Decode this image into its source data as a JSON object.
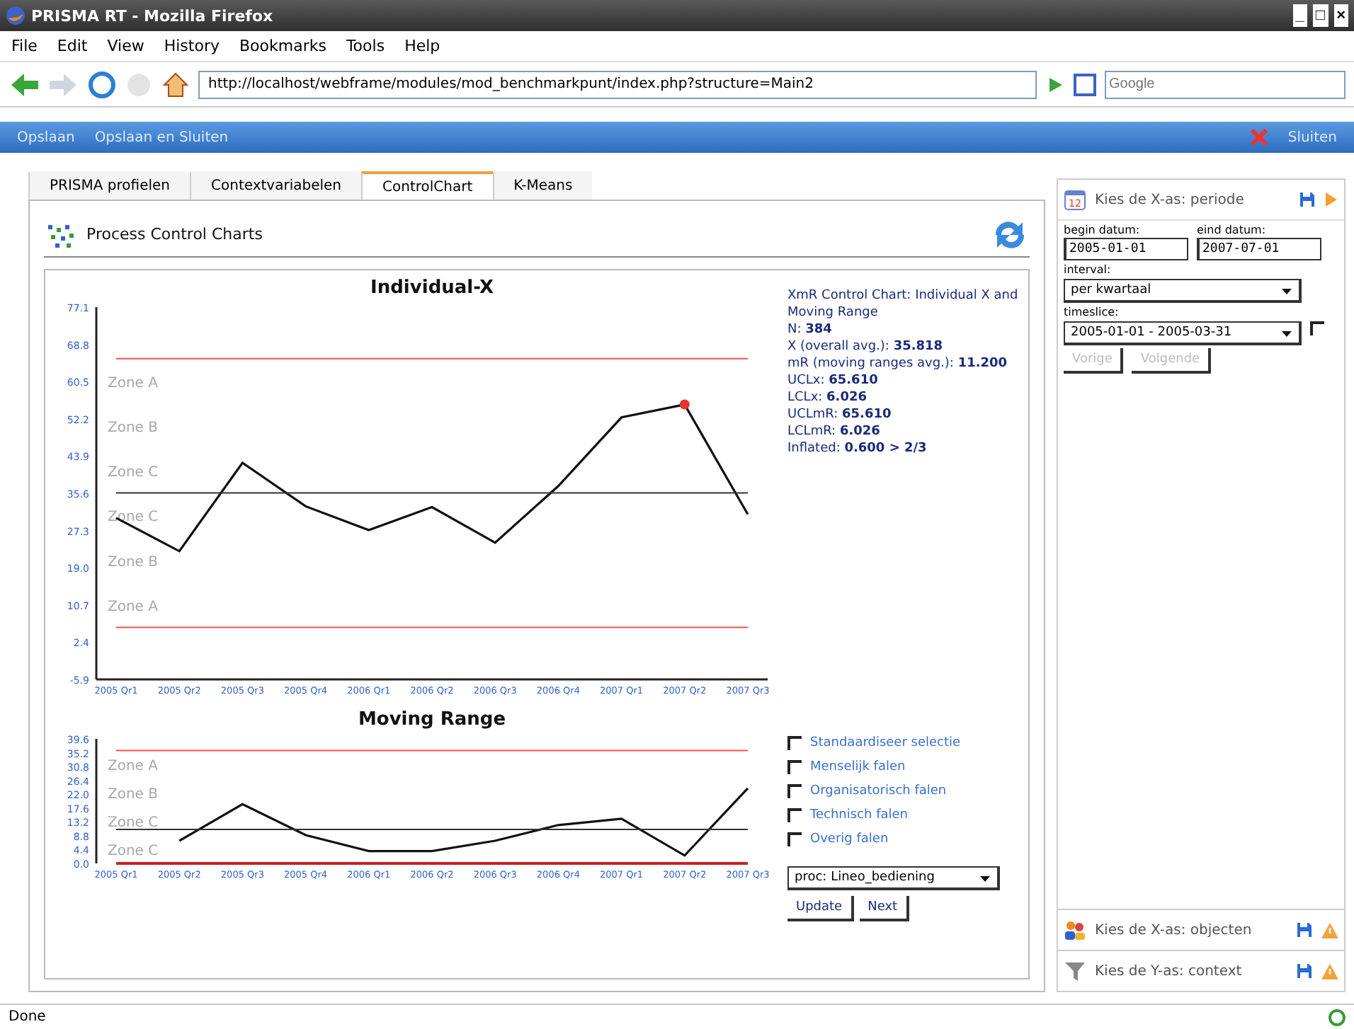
{
  "window": {
    "title": "PRISMA RT - Mozilla Firefox",
    "controls": [
      "_",
      "□",
      "×"
    ]
  },
  "menu": [
    "File",
    "Edit",
    "View",
    "History",
    "Bookmarks",
    "Tools",
    "Help"
  ],
  "address_bar": {
    "url": "http://localhost/webframe/modules/mod_benchmarkpunt/index.php?structure=Main2"
  },
  "search": {
    "placeholder": "Google"
  },
  "app_toolbar": {
    "left": [
      "Opslaan",
      "Opslaan en Sluiten"
    ],
    "right": "Sluiten"
  },
  "tabs": [
    {
      "label": "PRISMA profielen",
      "selected": false
    },
    {
      "label": "Contextvariabelen",
      "selected": false
    },
    {
      "label": "ControlChart",
      "selected": true
    },
    {
      "label": "K-Means",
      "selected": false
    }
  ],
  "panel": {
    "title": "Process Control Charts",
    "charts": [
      {
        "zones": [
          "Zone A",
          "Zone B",
          "Zone C",
          "Zone C",
          "Zone B",
          "Zone A"
        ],
        "chart_data": {
          "type": "line",
          "title": "Individual-X",
          "categories": [
            "2005 Qr1",
            "2005 Qr2",
            "2005 Qr3",
            "2005 Qr4",
            "2006 Qr1",
            "2006 Qr2",
            "2006 Qr3",
            "2006 Qr4",
            "2007 Qr1",
            "2007 Qr2",
            "2007 Qr3"
          ],
          "ylim": [
            -5.9,
            77.1
          ],
          "yticks": [
            {
              "value": 77.1,
              "label": "77.1"
            },
            {
              "value": 68.8,
              "label": "68.8"
            },
            {
              "value": 60.5,
              "label": "60.5"
            },
            {
              "value": 52.2,
              "label": "52.2"
            },
            {
              "value": 43.9,
              "label": "43.9"
            },
            {
              "value": 35.6,
              "label": "35.6"
            },
            {
              "value": 27.3,
              "label": "27.3"
            },
            {
              "value": 19.0,
              "label": "19.0"
            },
            {
              "value": 10.7,
              "label": "10.7"
            },
            {
              "value": 2.4,
              "label": "2.4"
            },
            {
              "value": -5.9,
              "label": "-5.9"
            }
          ],
          "series": [
            {
              "color": "#111111",
              "values": [
                30.1,
                22.7,
                42.4,
                32.7,
                27.4,
                32.5,
                24.6,
                37.2,
                52.5,
                55.4,
                30.9
              ]
            },
            {
              "color": "#ff4d4d",
              "values": [
                65.6,
                65.6,
                65.6,
                65.6,
                65.6,
                65.6,
                65.6,
                65.6,
                65.6,
                65.6,
                65.6
              ]
            },
            {
              "color": "#333333",
              "values": [
                35.7,
                35.7,
                35.7,
                35.7,
                35.7,
                35.7,
                35.7,
                35.7,
                35.7,
                35.7,
                35.7
              ]
            },
            {
              "color": "#ff4d4d",
              "values": [
                5.7,
                5.7,
                5.7,
                5.7,
                5.7,
                5.7,
                5.7,
                5.7,
                5.7,
                5.7,
                5.7
              ]
            },
            {
              "color": "#e8342c",
              "marker": true,
              "values": [
                null,
                null,
                null,
                null,
                null,
                null,
                null,
                null,
                null,
                55.4,
                null
              ]
            }
          ]
        }
      },
      {
        "zones": [
          "Zone A",
          "Zone B",
          "Zone C",
          "Zone C"
        ],
        "chart_data": {
          "type": "line",
          "title": "Moving Range",
          "categories": [
            "2005 Qr1",
            "2005 Qr2",
            "2005 Qr3",
            "2005 Qr4",
            "2006 Qr1",
            "2006 Qr2",
            "2006 Qr3",
            "2006 Qr4",
            "2007 Qr1",
            "2007 Qr2",
            "2007 Qr3"
          ],
          "ylim": [
            0,
            39.6
          ],
          "yticks": [
            {
              "value": 39.6,
              "label": "39.6"
            },
            {
              "value": 35.2,
              "label": "35.2"
            },
            {
              "value": 30.8,
              "label": "30.8"
            },
            {
              "value": 26.4,
              "label": "26.4"
            },
            {
              "value": 22.0,
              "label": "22.0"
            },
            {
              "value": 17.6,
              "label": "17.6"
            },
            {
              "value": 13.2,
              "label": "13.2"
            },
            {
              "value": 8.8,
              "label": "8.8"
            },
            {
              "value": 4.4,
              "label": "4.4"
            },
            {
              "value": 0,
              "label": "0.0"
            }
          ],
          "series": [
            {
              "color": "#111111",
              "values": [
                null,
                7.2,
                18.8,
                9.0,
                3.9,
                3.9,
                7.2,
                12.2,
                14.2,
                2.5,
                23.9
              ]
            },
            {
              "color": "#ff4d4d",
              "values": [
                35.9,
                35.9,
                35.9,
                35.9,
                35.9,
                35.9,
                35.9,
                35.9,
                35.9,
                35.9,
                35.9
              ]
            },
            {
              "color": "#333333",
              "values": [
                10.8,
                10.8,
                10.8,
                10.8,
                10.8,
                10.8,
                10.8,
                10.8,
                10.8,
                10.8,
                10.8
              ]
            },
            {
              "color": "#cc2222",
              "values": [
                0,
                0,
                0,
                0,
                0,
                0,
                0,
                0,
                0,
                0,
                0
              ]
            }
          ]
        }
      }
    ],
    "stats": [
      "XmR Control Chart: Individual X and Moving Range",
      "N: **384**",
      "X (overall avg.): **35.818**",
      "mR (moving ranges avg.): **11.200**",
      "UCLx: **65.610**",
      "LCLx: **6.026**",
      "UCLmR: **65.610**",
      "LCLmR: **6.026**",
      "Inflated: **0.600 > 2/3**"
    ],
    "filters": [
      {
        "label": "Standaardiseer selectie",
        "checked": false
      },
      {
        "label": "Menselijk falen",
        "checked": false
      },
      {
        "label": "Organisatorisch falen",
        "checked": false
      },
      {
        "label": "Technisch falen",
        "checked": false
      },
      {
        "label": "Overig falen",
        "checked": false
      }
    ],
    "process_select": {
      "value": "proc: Lineo_bediening"
    },
    "buttons": [
      "Update",
      "Next"
    ]
  },
  "sidebar": {
    "period": {
      "title": "Kies de X-as: periode",
      "calendar_day": "12",
      "begin": {
        "label": "begin datum:",
        "value": "2005-01-01"
      },
      "end": {
        "label": "eind datum:",
        "value": "2007-07-01"
      },
      "interval": {
        "label": "interval:",
        "value": "per kwartaal"
      },
      "timeslice": {
        "label": "timeslice:",
        "value": "2005-01-01 - 2005-03-31",
        "checked": false
      },
      "buttons": [
        {
          "label": "Vorige",
          "disabled": true
        },
        {
          "label": "Volgende",
          "disabled": true
        }
      ]
    },
    "sections": [
      {
        "title": "Kies de X-as: objecten",
        "kind": "people"
      },
      {
        "title": "Kies de Y-as: context",
        "kind": "funnel"
      }
    ]
  },
  "status_bar": "Done"
}
